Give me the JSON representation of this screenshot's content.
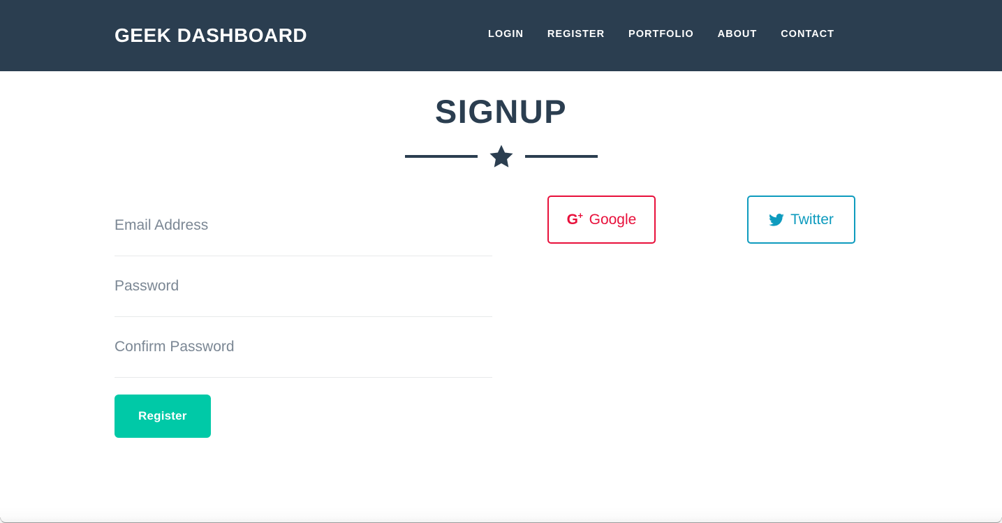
{
  "header": {
    "brand": "GEEK DASHBOARD",
    "nav": [
      {
        "label": "LOGIN",
        "name": "nav-link-login"
      },
      {
        "label": "REGISTER",
        "name": "nav-link-register"
      },
      {
        "label": "PORTFOLIO",
        "name": "nav-link-portfolio"
      },
      {
        "label": "ABOUT",
        "name": "nav-link-about"
      },
      {
        "label": "CONTACT",
        "name": "nav-link-contact"
      }
    ]
  },
  "page": {
    "title": "SIGNUP",
    "divider_icon": "star-icon"
  },
  "form": {
    "fields": [
      {
        "name": "email-field",
        "placeholder": "Email Address",
        "value": "",
        "type": "email"
      },
      {
        "name": "password-field",
        "placeholder": "Password",
        "value": "",
        "type": "password"
      },
      {
        "name": "confirm-password-field",
        "placeholder": "Confirm Password",
        "value": "",
        "type": "password"
      }
    ],
    "submit_label": "Register"
  },
  "social": {
    "google": {
      "label": "Google",
      "icon": "google-plus-icon",
      "icon_letter": "G",
      "icon_plus": "+"
    },
    "twitter": {
      "label": "Twitter",
      "icon": "twitter-bird-icon"
    }
  },
  "colors": {
    "navbar_bg": "#2b3e50",
    "heading": "#2b3e50",
    "register_button": "#00c9a7",
    "google_accent": "#e8103b",
    "twitter_accent": "#0e9bbe",
    "placeholder_text": "#7b8794",
    "input_underline": "#e7e9ea",
    "page_bg": "#ffffff"
  }
}
